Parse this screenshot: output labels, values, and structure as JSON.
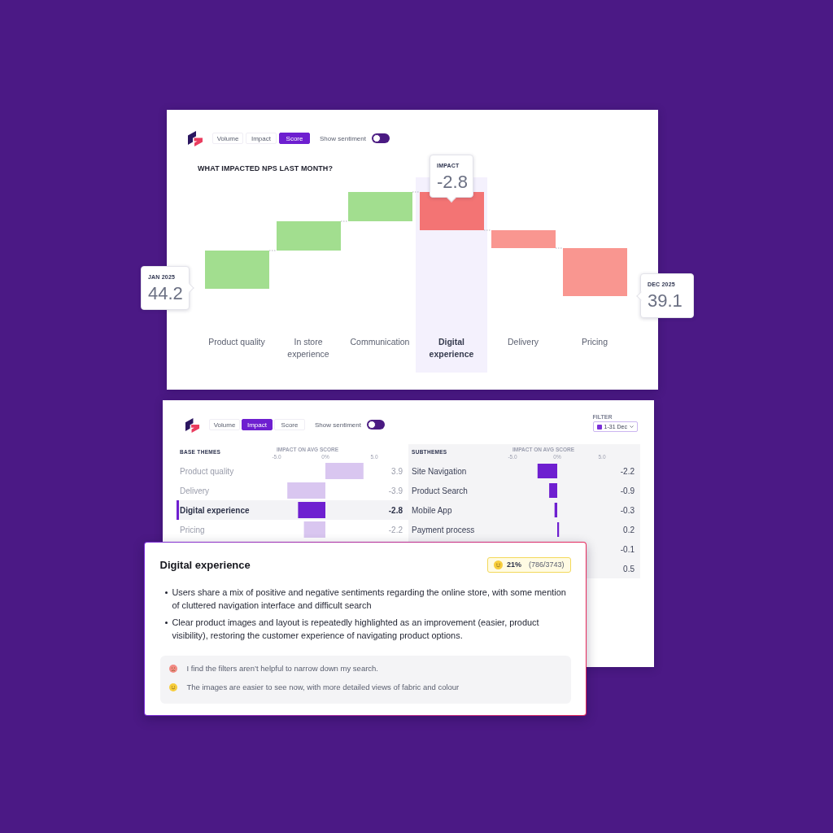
{
  "top_card": {
    "toolbar": {
      "options": [
        {
          "label": "Volume",
          "selected": false
        },
        {
          "label": "Impact",
          "selected": false
        },
        {
          "label": "Score",
          "selected": true
        }
      ],
      "sentiment_toggle": {
        "label": "Show sentiment",
        "on": false
      }
    },
    "chart": {
      "title": "WHAT IMPACTED NPS LAST MONTH?",
      "categories": [
        {
          "label": "Product quality",
          "kind": "rise",
          "selected": false
        },
        {
          "label": "In store experience",
          "kind": "rise",
          "selected": false
        },
        {
          "label": "Communication",
          "kind": "rise",
          "selected": false
        },
        {
          "label": "Digital experience",
          "kind": "fall",
          "selected": true
        },
        {
          "label": "Delivery",
          "kind": "fall",
          "selected": false
        },
        {
          "label": "Pricing",
          "kind": "fall",
          "selected": false
        }
      ],
      "start_callout": {
        "label": "JAN 2025",
        "value": "44.2"
      },
      "impact_callout": {
        "label": "IMPACT",
        "value": "-2.8"
      },
      "end_callout": {
        "label": "DEC 2025",
        "value": "39.1"
      }
    }
  },
  "bottom_card": {
    "toolbar": {
      "options": [
        {
          "label": "Volume",
          "selected": false
        },
        {
          "label": "Impact",
          "selected": true
        },
        {
          "label": "Score",
          "selected": false
        }
      ],
      "sentiment_toggle": {
        "label": "Show sentiment",
        "on": false
      }
    },
    "filter": {
      "label": "FILTER",
      "value": "1-31 Dec"
    },
    "base_themes": {
      "title": "BASE THEMES",
      "axis_title": "IMPACT ON AVG SCORE",
      "chart_data": {
        "type": "bar",
        "orientation": "horizontal",
        "categories": [
          "Product quality",
          "Delivery",
          "Digital experience",
          "Pricing"
        ],
        "values": [
          3.9,
          -3.9,
          -2.8,
          -2.2
        ],
        "value_labels": [
          "3.9",
          "-3.9",
          "-2.8",
          "-2.2"
        ],
        "xlim": [
          -5,
          5
        ],
        "xticks": [
          {
            "value": -5,
            "label": "-5.0"
          },
          {
            "value": 0,
            "label": "0%"
          },
          {
            "value": 5,
            "label": "5.0"
          }
        ]
      },
      "rows": [
        {
          "selected": false
        },
        {
          "selected": false
        },
        {
          "selected": true
        },
        {
          "selected": false
        }
      ]
    },
    "subthemes": {
      "title": "SUBTHEMES",
      "axis_title": "IMPACT ON AVG SCORE",
      "chart_data": {
        "type": "bar",
        "orientation": "horizontal",
        "categories": [
          "Site Navigation",
          "Product Search",
          "Mobile App",
          "Payment process",
          null,
          null
        ],
        "values": [
          -2.2,
          -0.9,
          -0.3,
          0.2,
          null,
          null
        ],
        "value_labels": [
          "-2.2",
          "-0.9",
          "-0.3",
          "0.2",
          "-0.1",
          "0.5"
        ],
        "xlim": [
          -5,
          5
        ],
        "xticks": [
          {
            "value": -5,
            "label": "-5.0"
          },
          {
            "value": 0,
            "label": "0%"
          },
          {
            "value": 5,
            "label": "5.0"
          }
        ]
      }
    }
  },
  "detail_popup": {
    "title": "Digital experience",
    "sentiment_badge": {
      "percent": "21%",
      "count": "(786/3743)"
    },
    "bullets": [
      "Users share a mix of positive and negative sentiments regarding the online store, with some mention of cluttered navigation interface and difficult search",
      "Clear product images and layout is repeatedly highlighted as an improvement (easier, product visibility), restoring the customer experience of navigating product options."
    ],
    "quotes": [
      {
        "kind": "negative",
        "text": "I find the filters aren’t helpful to narrow down my search."
      },
      {
        "kind": "positive",
        "text": "The images are easier to see now, with more detailed views of fabric and colour"
      }
    ]
  }
}
